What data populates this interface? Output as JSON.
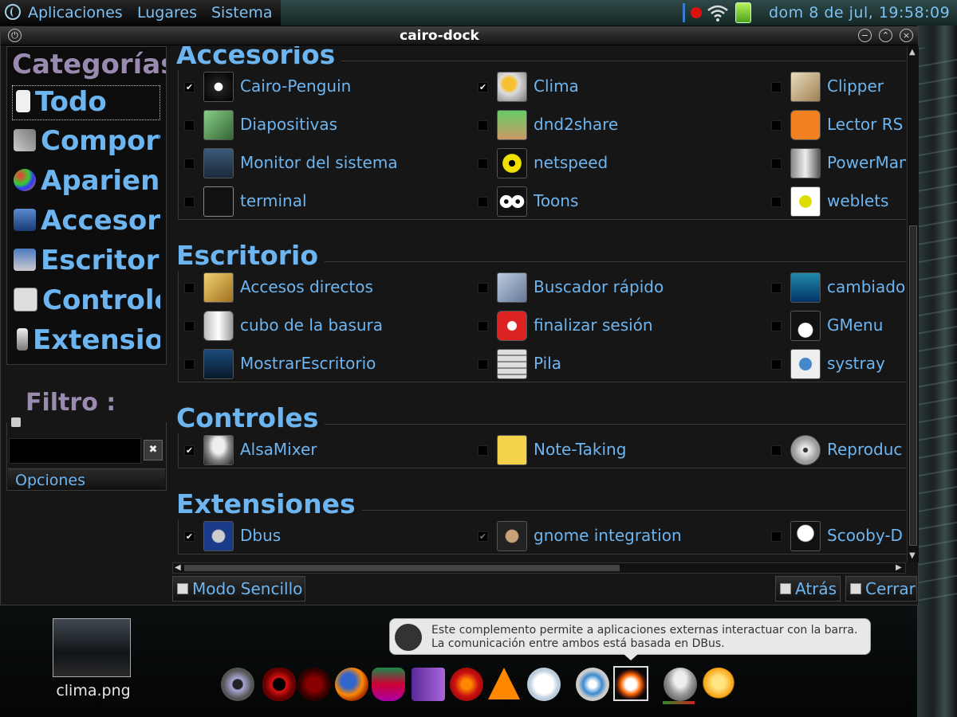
{
  "panel": {
    "menus": [
      "Aplicaciones",
      "Lugares",
      "Sistema"
    ],
    "clock": "dom  8 de jul, 19:58:09"
  },
  "window": {
    "title": "cairo-dock"
  },
  "sidebar": {
    "title": "Categorías",
    "items": [
      {
        "label": "Todo",
        "icon": "document-icon",
        "selected": true
      },
      {
        "label": "Comportamiento",
        "icon": "tools-icon"
      },
      {
        "label": "Apariencia",
        "icon": "palette-icon"
      },
      {
        "label": "Accesorios",
        "icon": "accessories-icon"
      },
      {
        "label": "Escritorio",
        "icon": "desktop-icon"
      },
      {
        "label": "Controles",
        "icon": "controls-icon"
      },
      {
        "label": "Extensiones",
        "icon": "plug-icon"
      }
    ]
  },
  "filter": {
    "title": "Filtro :",
    "value": "",
    "options_label": "Opciones"
  },
  "groups": [
    {
      "title": "Accesorios",
      "items": [
        {
          "label": "Cairo-Penguin",
          "checked": true,
          "icon": "penguin-icon"
        },
        {
          "label": "Clima",
          "checked": true,
          "icon": "weather-icon"
        },
        {
          "label": "Clipper",
          "checked": false,
          "icon": "clipboard-icon"
        },
        {
          "label": "Diapositivas",
          "checked": false,
          "icon": "slideshow-icon"
        },
        {
          "label": "dnd2share",
          "checked": false,
          "icon": "share-icon"
        },
        {
          "label": "Lector RS",
          "checked": false,
          "icon": "rss-icon"
        },
        {
          "label": "Monitor del sistema",
          "checked": false,
          "icon": "system-monitor-icon"
        },
        {
          "label": "netspeed",
          "checked": false,
          "icon": "netspeed-icon"
        },
        {
          "label": "PowerMan",
          "checked": false,
          "icon": "power-manager-icon"
        },
        {
          "label": "terminal",
          "checked": false,
          "icon": "terminal-icon"
        },
        {
          "label": "Toons",
          "checked": false,
          "icon": "eyes-icon"
        },
        {
          "label": "weblets",
          "checked": false,
          "icon": "weblets-icon"
        }
      ]
    },
    {
      "title": "Escritorio",
      "items": [
        {
          "label": "Accesos directos",
          "checked": false,
          "icon": "shortcuts-icon"
        },
        {
          "label": "Buscador rápido",
          "checked": false,
          "icon": "quick-search-icon"
        },
        {
          "label": "cambiado",
          "checked": false,
          "icon": "switcher-icon"
        },
        {
          "label": "cubo de la basura",
          "checked": false,
          "icon": "trash-icon"
        },
        {
          "label": "finalizar sesión",
          "checked": false,
          "icon": "logout-icon"
        },
        {
          "label": "GMenu",
          "checked": false,
          "icon": "gmenu-icon"
        },
        {
          "label": "MostrarEscritorio",
          "checked": false,
          "icon": "show-desktop-icon"
        },
        {
          "label": "Pila",
          "checked": false,
          "icon": "stack-icon"
        },
        {
          "label": "systray",
          "checked": false,
          "icon": "info-icon"
        }
      ]
    },
    {
      "title": "Controles",
      "items": [
        {
          "label": "AlsaMixer",
          "checked": true,
          "icon": "mixer-icon"
        },
        {
          "label": "Note-Taking",
          "checked": false,
          "icon": "note-icon"
        },
        {
          "label": "Reproduc",
          "checked": false,
          "icon": "player-icon"
        }
      ]
    },
    {
      "title": "Extensiones",
      "items": [
        {
          "label": "Dbus",
          "checked": true,
          "icon": "dbus-icon"
        },
        {
          "label": "gnome integration",
          "checked": true,
          "icon": "gnome-foot-icon"
        },
        {
          "label": "Scooby-D",
          "checked": false,
          "icon": "scooby-icon"
        }
      ]
    }
  ],
  "buttons": {
    "simple_mode": "Modo Sencillo",
    "back": "Atrás",
    "close": "Cerrar"
  },
  "desktop": {
    "file_label": "clima.png"
  },
  "tooltip": {
    "line1": "Este complemento permite a aplicaciones externas interactuar con la barra.",
    "line2": "La comunicación entre ambos está basada en DBus."
  },
  "dock": {
    "items": [
      "globe-icon",
      "opera-icon",
      "red-app-icon",
      "firefox-icon",
      "inkscape-icon",
      "book-icon",
      "ccleaner-icon",
      "vlc-icon",
      "bluetooth-icon",
      "safari-icon",
      "cairo-dock-icon",
      "mixer-icon",
      "weather-icon"
    ]
  },
  "colors": {
    "accent_text": "#6db5f0",
    "category_title": "#9b8ab0",
    "window_bg": "#161616"
  }
}
